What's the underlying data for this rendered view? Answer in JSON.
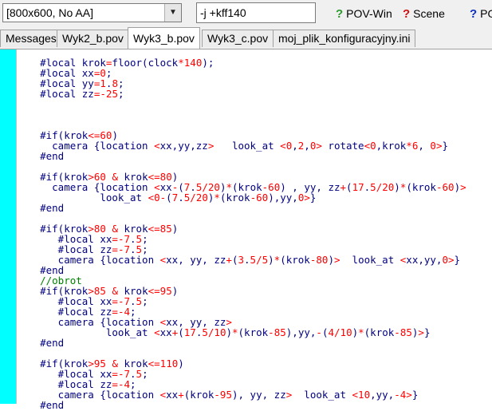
{
  "toolbar": {
    "resolution": "[800x600, No AA]",
    "command_line": "-j +kff140",
    "povwin_label": "POV-Win",
    "scene_label": "Scene",
    "extra_label": "PO"
  },
  "tabs": [
    {
      "label": "Messages"
    },
    {
      "label": "Wyk2_b.pov"
    },
    {
      "label": "Wyk3_b.pov",
      "active": true
    },
    {
      "label": "Wyk3_c.pov"
    },
    {
      "label": "moj_plik_konfiguracyjny.ini"
    }
  ],
  "code_lines": [
    "    #local krok=floor(clock*140);",
    "    #local xx=0;",
    "    #local yy=1.8;",
    "    #local zz=-25;",
    "",
    "",
    "",
    "    #if(krok<=60)",
    "      camera {location <xx,yy,zz>   look_at <0,2,0> rotate<0,krok*6, 0>}",
    "    #end",
    "",
    "    #if(krok>60 & krok<=80)",
    "      camera {location <xx-(7.5/20)*(krok-60) , yy, zz+(17.5/20)*(krok-60)>",
    "              look_at <0-(7.5/20)*(krok-60),yy,0>}",
    "    #end",
    "",
    "    #if(krok>80 & krok<=85)",
    "       #local xx=-7.5;",
    "       #local zz=-7.5;",
    "       camera {location <xx, yy, zz+(3.5/5)*(krok-80)>  look_at <xx,yy,0>}",
    "    #end",
    "    //obrot",
    "    #if(krok>85 & krok<=95)",
    "       #local xx=-7.5;",
    "       #local zz=-4;",
    "       camera {location <xx, yy, zz>",
    "               look_at <xx+(17.5/10)*(krok-85),yy,-(4/10)*(krok-85)>}",
    "    #end",
    "",
    "    #if(krok>95 & krok<=110)",
    "       #local xx=-7.5;",
    "       #local zz=-4;",
    "       camera {location <xx+(krok-95), yy, zz>  look_at <10,yy,-4>}",
    "    #end"
  ],
  "colors": {
    "keyword": "#000080",
    "operator": "#ff0000",
    "comment": "#008000",
    "gutter": "#00ffff"
  }
}
